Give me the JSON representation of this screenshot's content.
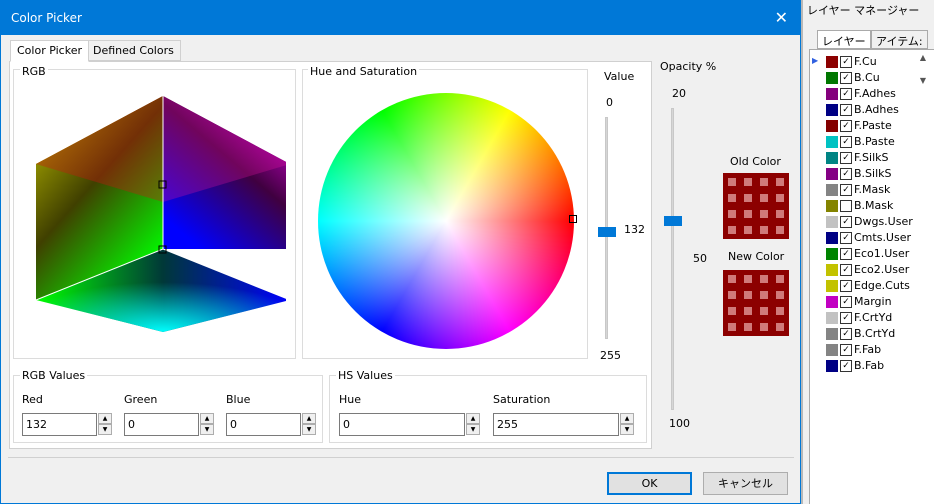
{
  "dialog": {
    "title": "Color Picker",
    "tabs": [
      "Color Picker",
      "Defined Colors"
    ],
    "rgb_label": "RGB",
    "hs_label": "Hue and Saturation",
    "value_label": "Value",
    "value_min": "0",
    "value_max": "255",
    "value_current": "132",
    "opacity_label": "Opacity %",
    "opacity_min": "20",
    "opacity_mid": "50",
    "opacity_max": "100",
    "old_color_label": "Old Color",
    "new_color_label": "New Color",
    "swatch_color": "#8c0000",
    "rgb_values_label": "RGB Values",
    "red_label": "Red",
    "green_label": "Green",
    "blue_label": "Blue",
    "red": "132",
    "green": "0",
    "blue": "0",
    "hs_values_label": "HS Values",
    "hue_label": "Hue",
    "saturation_label": "Saturation",
    "hue": "0",
    "saturation": "255",
    "ok_label": "OK",
    "cancel_label": "キャンセル"
  },
  "layer_manager": {
    "title": "レイヤー マネージャー",
    "tabs": [
      "レイヤー",
      "アイテム:"
    ],
    "layers": [
      {
        "name": "F.Cu",
        "color": "#8c0000",
        "checked": true
      },
      {
        "name": "B.Cu",
        "color": "#007700",
        "checked": true
      },
      {
        "name": "F.Adhes",
        "color": "#84007c",
        "checked": true
      },
      {
        "name": "B.Adhes",
        "color": "#000084",
        "checked": true
      },
      {
        "name": "F.Paste",
        "color": "#840000",
        "checked": true
      },
      {
        "name": "B.Paste",
        "color": "#00c2c2",
        "checked": true
      },
      {
        "name": "F.SilkS",
        "color": "#008484",
        "checked": true
      },
      {
        "name": "B.SilkS",
        "color": "#840084",
        "checked": true
      },
      {
        "name": "F.Mask",
        "color": "#848484",
        "checked": true
      },
      {
        "name": "B.Mask",
        "color": "#848400",
        "checked": false
      },
      {
        "name": "Dwgs.User",
        "color": "#c2c2c2",
        "checked": true
      },
      {
        "name": "Cmts.User",
        "color": "#000084",
        "checked": true
      },
      {
        "name": "Eco1.User",
        "color": "#008400",
        "checked": true
      },
      {
        "name": "Eco2.User",
        "color": "#c2c200",
        "checked": true
      },
      {
        "name": "Edge.Cuts",
        "color": "#c2c200",
        "checked": true
      },
      {
        "name": "Margin",
        "color": "#c200c2",
        "checked": true
      },
      {
        "name": "F.CrtYd",
        "color": "#c2c2c2",
        "checked": true
      },
      {
        "name": "B.CrtYd",
        "color": "#848484",
        "checked": true
      },
      {
        "name": "F.Fab",
        "color": "#848484",
        "checked": true
      },
      {
        "name": "B.Fab",
        "color": "#000084",
        "checked": true
      }
    ]
  }
}
